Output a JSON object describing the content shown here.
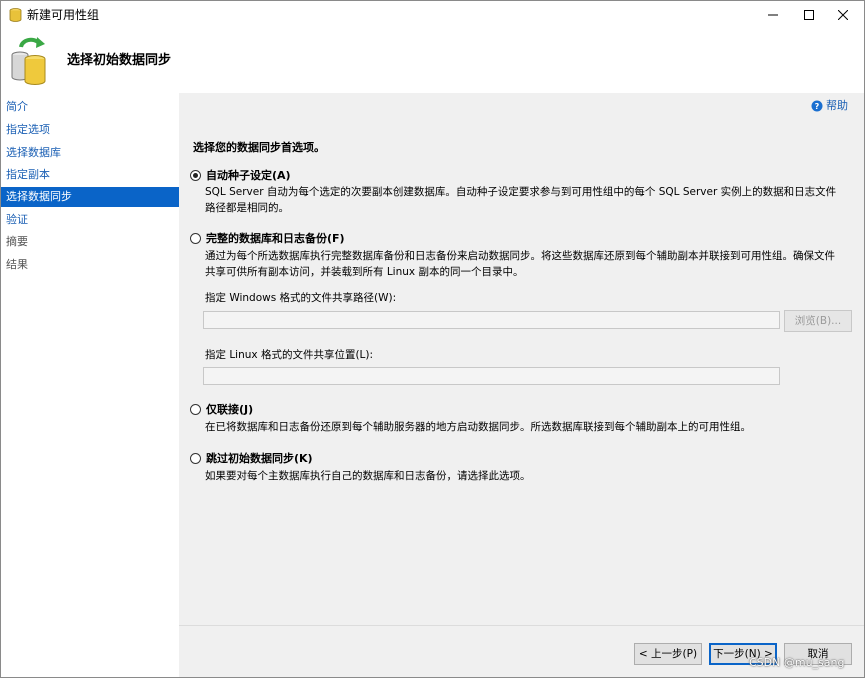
{
  "window": {
    "title": "新建可用性组",
    "header_title": "选择初始数据同步"
  },
  "nav": {
    "items": [
      {
        "label": "简介",
        "state": "link"
      },
      {
        "label": "指定选项",
        "state": "link"
      },
      {
        "label": "选择数据库",
        "state": "link"
      },
      {
        "label": "指定副本",
        "state": "link"
      },
      {
        "label": "选择数据同步",
        "state": "active"
      },
      {
        "label": "验证",
        "state": "link"
      },
      {
        "label": "摘要",
        "state": "disabled"
      },
      {
        "label": "结果",
        "state": "disabled"
      }
    ]
  },
  "main": {
    "help_label": "帮助",
    "intro": "选择您的数据同步首选项。",
    "options": [
      {
        "label": "自动种子设定(A)",
        "checked": true,
        "description": "SQL Server 自动为每个选定的次要副本创建数据库。自动种子设定要求参与到可用性组中的每个 SQL Server 实例上的数据和日志文件路径都是相同的。"
      },
      {
        "label": "完整的数据库和日志备份(F)",
        "checked": false,
        "description": "通过为每个所选数据库执行完整数据库备份和日志备份来启动数据同步。将这些数据库还原到每个辅助副本并联接到可用性组。确保文件共享可供所有副本访问，并装载到所有 Linux 副本的同一个目录中。"
      },
      {
        "label": "仅联接(J)",
        "checked": false,
        "description": "在已将数据库和日志备份还原到每个辅助服务器的地方启动数据同步。所选数据库联接到每个辅助副本上的可用性组。"
      },
      {
        "label": "跳过初始数据同步(K)",
        "checked": false,
        "description": "如果要对每个主数据库执行自己的数据库和日志备份，请选择此选项。"
      }
    ],
    "windows_share_label": "指定 Windows 格式的文件共享路径(W):",
    "windows_share_value": "",
    "linux_share_label": "指定 Linux 格式的文件共享位置(L):",
    "linux_share_value": "",
    "browse_label": "浏览(B)..."
  },
  "footer": {
    "back_label": "< 上一步(P)",
    "next_label": "下一步(N) >",
    "cancel_label": "取消"
  },
  "watermark": "CSDN @mu_sang",
  "colors": {
    "accent": "#0a64c8",
    "link": "#1a5fb4",
    "panel_bg": "#f0f0f0"
  }
}
